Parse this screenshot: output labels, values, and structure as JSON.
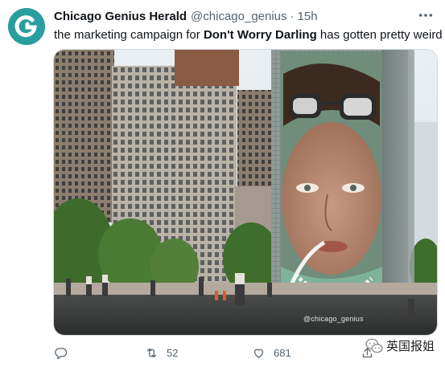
{
  "tweet": {
    "display_name": "Chicago Genius Herald",
    "handle": "@chicago_genius",
    "separator": "·",
    "time": "15h",
    "text_before": "the marketing campaign for ",
    "text_bold": "Don't Worry Darling",
    "text_after": " has gotten pretty weird"
  },
  "photo": {
    "watermark": "@chicago_genius"
  },
  "actions": {
    "reply_count": "",
    "retweet_count": "52",
    "like_count": "681"
  },
  "overlay_watermark": {
    "text": "英国报姐"
  },
  "icons": {
    "avatar": "chicago-genius-logo",
    "more": "more-dots-icon",
    "reply": "reply-bubble-icon",
    "retweet": "retweet-icon",
    "like": "heart-icon",
    "share": "share-icon"
  },
  "colors": {
    "avatar_bg": "#2a9d9f",
    "secondary_text": "#536471",
    "primary_text": "#0f1419"
  }
}
